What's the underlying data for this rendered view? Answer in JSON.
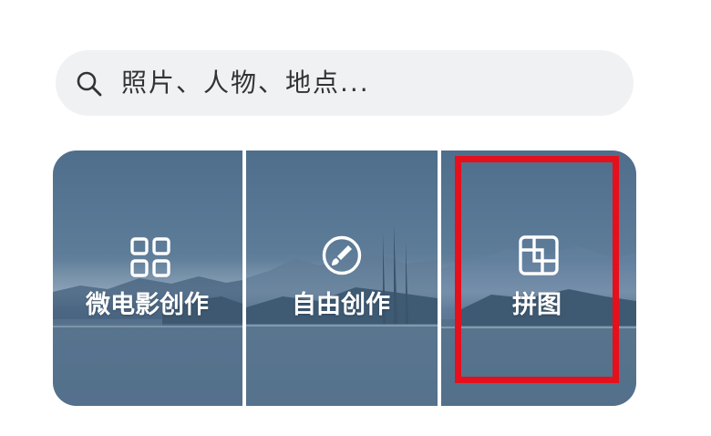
{
  "search": {
    "placeholder": "照片、人物、地点..."
  },
  "cards": [
    {
      "label": "微电影创作",
      "icon": "grid-icon"
    },
    {
      "label": "自由创作",
      "icon": "paint-brush-icon"
    },
    {
      "label": "拼图",
      "icon": "collage-icon"
    }
  ],
  "colors": {
    "highlight": "#e5101c",
    "search_bg": "#f0f1f3",
    "card_bg": "#56738f"
  }
}
